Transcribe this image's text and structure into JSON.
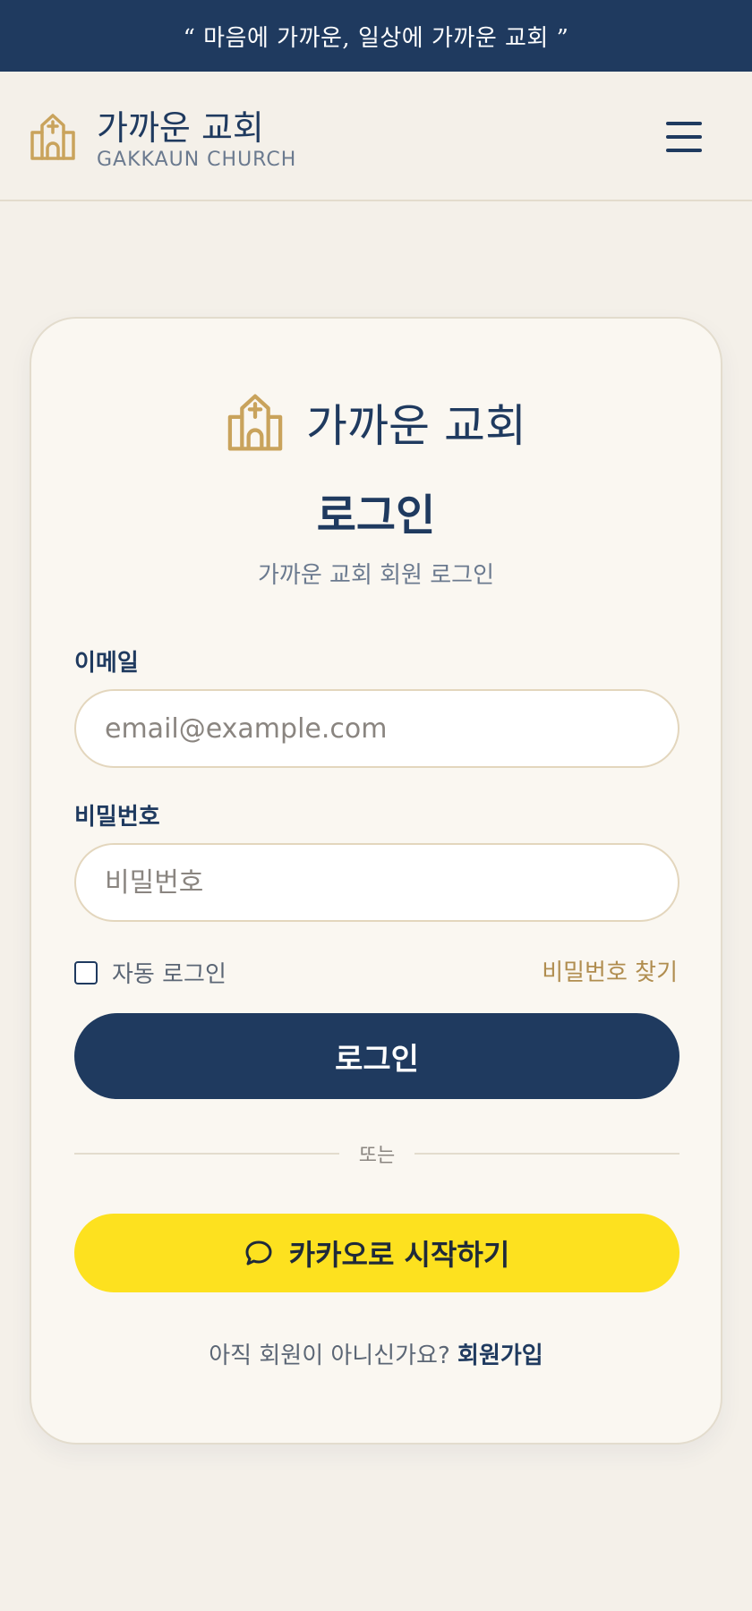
{
  "top_banner": {
    "text": "“ 마음에 가까운, 일상에 가까운 교회 ”"
  },
  "header": {
    "brand_name": "가까운 교회",
    "brand_sub": "GAKKAUN CHURCH",
    "logo_icon": "church-icon",
    "menu_icon": "hamburger-menu-icon"
  },
  "card": {
    "brand_name": "가까운 교회",
    "title": "로그인",
    "subtitle": "가까운 교회 회원 로그인",
    "email": {
      "label": "이메일",
      "placeholder": "email@example.com",
      "value": ""
    },
    "password": {
      "label": "비밀번호",
      "placeholder": "비밀번호",
      "value": ""
    },
    "remember_label": "자동 로그인",
    "remember_checked": false,
    "find_password": "비밀번호 찾기",
    "login_button": "로그인",
    "divider_text": "또는",
    "kakao_button": "카카오로 시작하기",
    "kakao_icon": "speech-bubble-icon",
    "signup_prompt": "아직 회원이 아니신가요? ",
    "signup_link": "회원가입"
  },
  "colors": {
    "navy": "#1f3a5f",
    "gold": "#c9a35c",
    "kakao_yellow": "#fde11f",
    "background": "#f4f0e9",
    "card_background": "#faf7f1"
  }
}
